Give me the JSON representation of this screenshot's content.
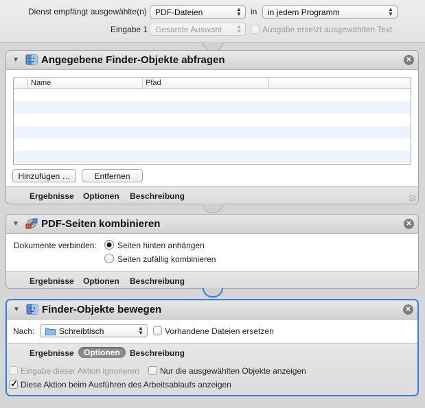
{
  "header": {
    "service_label": "Dienst empfängt ausgewählte(n)",
    "service_value": "PDF-Dateien",
    "in_label": "in",
    "app_value": "in jedem Programm",
    "input_label": "Eingabe 1",
    "input_value": "Gesamte Auswahl",
    "replace_label": "Ausgabe ersetzt ausgewählten Text"
  },
  "actions": [
    {
      "title": "Angegebene Finder-Objekte abfragen",
      "icon": "finder-icon",
      "columns": [
        "Name",
        "Pfad"
      ],
      "rows": [],
      "add_button": "Hinzufügen …",
      "remove_button": "Entfernen",
      "tabs": [
        "Ergebnisse",
        "Optionen",
        "Beschreibung"
      ]
    },
    {
      "title": "PDF-Seiten kombinieren",
      "icon": "pdf-combine-icon",
      "field_label": "Dokumente verbinden:",
      "options": [
        "Seiten hinten anhängen",
        "Seiten zufällig kombinieren"
      ],
      "selected_option": "Seiten hinten anhängen",
      "tabs": [
        "Ergebnisse",
        "Optionen",
        "Beschreibung"
      ]
    },
    {
      "title": "Finder-Objekte bewegen",
      "icon": "finder-icon",
      "to_label": "Nach:",
      "to_value": "Schreibtisch",
      "replace_label": "Vorhandene Dateien ersetzen",
      "replace_checked": false,
      "tabs": [
        "Ergebnisse",
        "Optionen",
        "Beschreibung"
      ],
      "active_tab": "Optionen",
      "option_ignore_input": "Eingabe dieser Aktion ignorieren",
      "option_only_selected": "Nur die ausgewählten Objekte anzeigen",
      "option_show_when_run": "Diese Aktion beim Ausführen des Arbeitsablaufs anzeigen",
      "show_when_run_checked": true
    }
  ],
  "colors": {
    "selection": "#3b78d9",
    "alt_row": "#edf3fc"
  }
}
